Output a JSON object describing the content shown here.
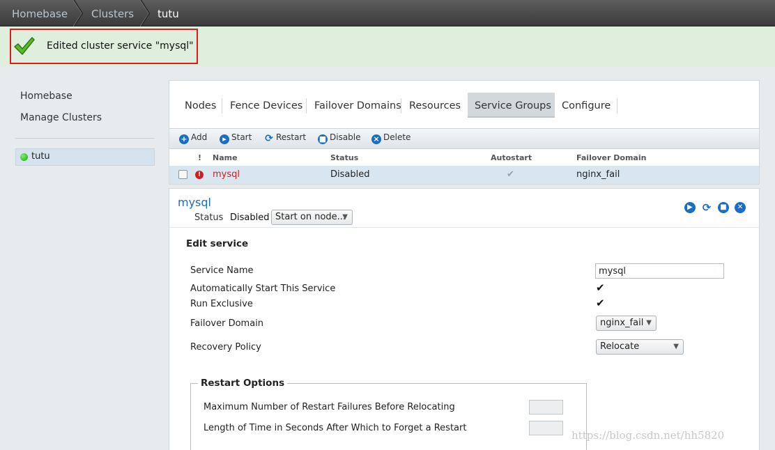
{
  "breadcrumb": [
    "Homebase",
    "Clusters",
    "tutu"
  ],
  "notification": {
    "message": "Edited cluster service \"mysql\"",
    "status": "success"
  },
  "sidebar": {
    "links": [
      "Homebase",
      "Manage Clusters"
    ],
    "clusters": [
      {
        "name": "tutu",
        "status": "online"
      }
    ]
  },
  "tabs": [
    "Nodes",
    "Fence Devices",
    "Failover Domains",
    "Resources",
    "Service Groups",
    "Configure"
  ],
  "active_tab": "Service Groups",
  "toolbar": {
    "add": "Add",
    "start": "Start",
    "restart": "Restart",
    "disable": "Disable",
    "delete": "Delete"
  },
  "table": {
    "headers": {
      "alert": "!",
      "name": "Name",
      "status": "Status",
      "autostart": "Autostart",
      "failover": "Failover Domain"
    },
    "rows": [
      {
        "name": "mysql",
        "status": "Disabled",
        "autostart": true,
        "failover": "nginx_fail"
      }
    ]
  },
  "service": {
    "title": "mysql",
    "status_label": "Status",
    "status_value": "Disabled",
    "start_select": "Start on node..."
  },
  "edit": {
    "heading": "Edit service",
    "service_name_label": "Service Name",
    "service_name_value": "mysql",
    "autostart_label": "Automatically Start This Service",
    "autostart_checked": true,
    "exclusive_label": "Run Exclusive",
    "exclusive_checked": true,
    "failover_label": "Failover Domain",
    "failover_value": "nginx_fail",
    "recovery_label": "Recovery Policy",
    "recovery_value": "Relocate"
  },
  "restart_options": {
    "legend": "Restart Options",
    "max_failures_label": "Maximum Number of Restart Failures Before Relocating",
    "max_failures_value": "",
    "forget_label": "Length of Time in Seconds After Which to Forget a Restart",
    "forget_value": ""
  },
  "watermark": "https://blog.csdn.net/hh5820",
  "colors": {
    "accent": "#1a6ec2",
    "alert": "#d21d1d",
    "success_bg": "#dfeedd",
    "highlight": "#e01b1b"
  }
}
